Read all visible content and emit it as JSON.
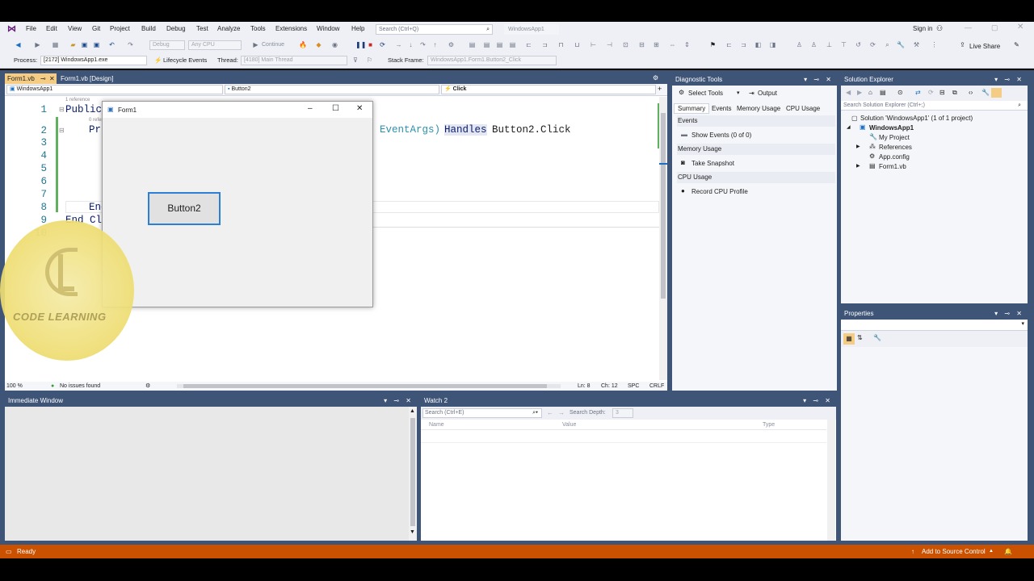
{
  "menu": {
    "items": [
      "File",
      "Edit",
      "View",
      "Git",
      "Project",
      "Build",
      "Debug",
      "Test",
      "Analyze",
      "Tools",
      "Extensions",
      "Window",
      "Help"
    ],
    "search_placeholder": "Search (Ctrl+Q)",
    "solution_name": "WindowsApp1",
    "sign_in": "Sign in"
  },
  "toolbar": {
    "config": "Debug",
    "platform": "Any CPU",
    "continue": "Continue",
    "live_share": "Live Share"
  },
  "toolbar2": {
    "process_label": "Process:",
    "process_value": "[2172] WindowsApp1.exe",
    "lifecycle": "Lifecycle Events",
    "thread_label": "Thread:",
    "thread_value": "[4180] Main Thread",
    "stack_label": "Stack Frame:",
    "stack_value": "WindowsApp1.Form1.Button2_Click"
  },
  "editor": {
    "tab_active": "Form1.vb",
    "tab_inactive": "Form1.vb [Design]",
    "nav_project": "WindowsApp1",
    "nav_object": "Button2",
    "nav_member": "Click",
    "ref_hint1": "1 reference",
    "ref_hint2": "0 refere",
    "lines": [
      "1",
      "2",
      "3",
      "4",
      "5",
      "6",
      "7",
      "8",
      "9",
      "10"
    ],
    "line1": "Public",
    "line2_start": "Pr",
    "line2_end_a": "EventArgs)",
    "line2_kw": "Handles",
    "line2_end_b": "Button2.Click",
    "line8": "End",
    "line9": "End Cl",
    "zoom": "100 %",
    "issues": "No issues found",
    "ln": "Ln: 8",
    "ch": "Ch: 12",
    "spc": "SPC",
    "crlf": "CRLF"
  },
  "form": {
    "title": "Form1",
    "button": "Button2"
  },
  "watermark": {
    "text": "CODE LEARNING"
  },
  "diagnostics": {
    "title": "Diagnostic Tools",
    "select_tools": "Select Tools",
    "output": "Output",
    "tabs": [
      "Summary",
      "Events",
      "Memory Usage",
      "CPU Usage"
    ],
    "events_hdr": "Events",
    "show_events": "Show Events (0 of 0)",
    "memory_hdr": "Memory Usage",
    "take_snapshot": "Take Snapshot",
    "cpu_hdr": "CPU Usage",
    "record_cpu": "Record CPU Profile"
  },
  "solution_explorer": {
    "title": "Solution Explorer",
    "search_placeholder": "Search Solution Explorer (Ctrl+;)",
    "solution": "Solution 'WindowsApp1' (1 of 1 project)",
    "project": "WindowsApp1",
    "items": [
      "My Project",
      "References",
      "App.config",
      "Form1.vb"
    ]
  },
  "properties": {
    "title": "Properties"
  },
  "immediate": {
    "title": "Immediate Window"
  },
  "watch": {
    "title": "Watch 2",
    "search_placeholder": "Search (Ctrl+E)",
    "search_depth": "Search Depth:",
    "depth_value": "3",
    "columns": [
      "Name",
      "Value",
      "Type"
    ]
  },
  "status": {
    "ready": "Ready",
    "source_control": "Add to Source Control"
  }
}
